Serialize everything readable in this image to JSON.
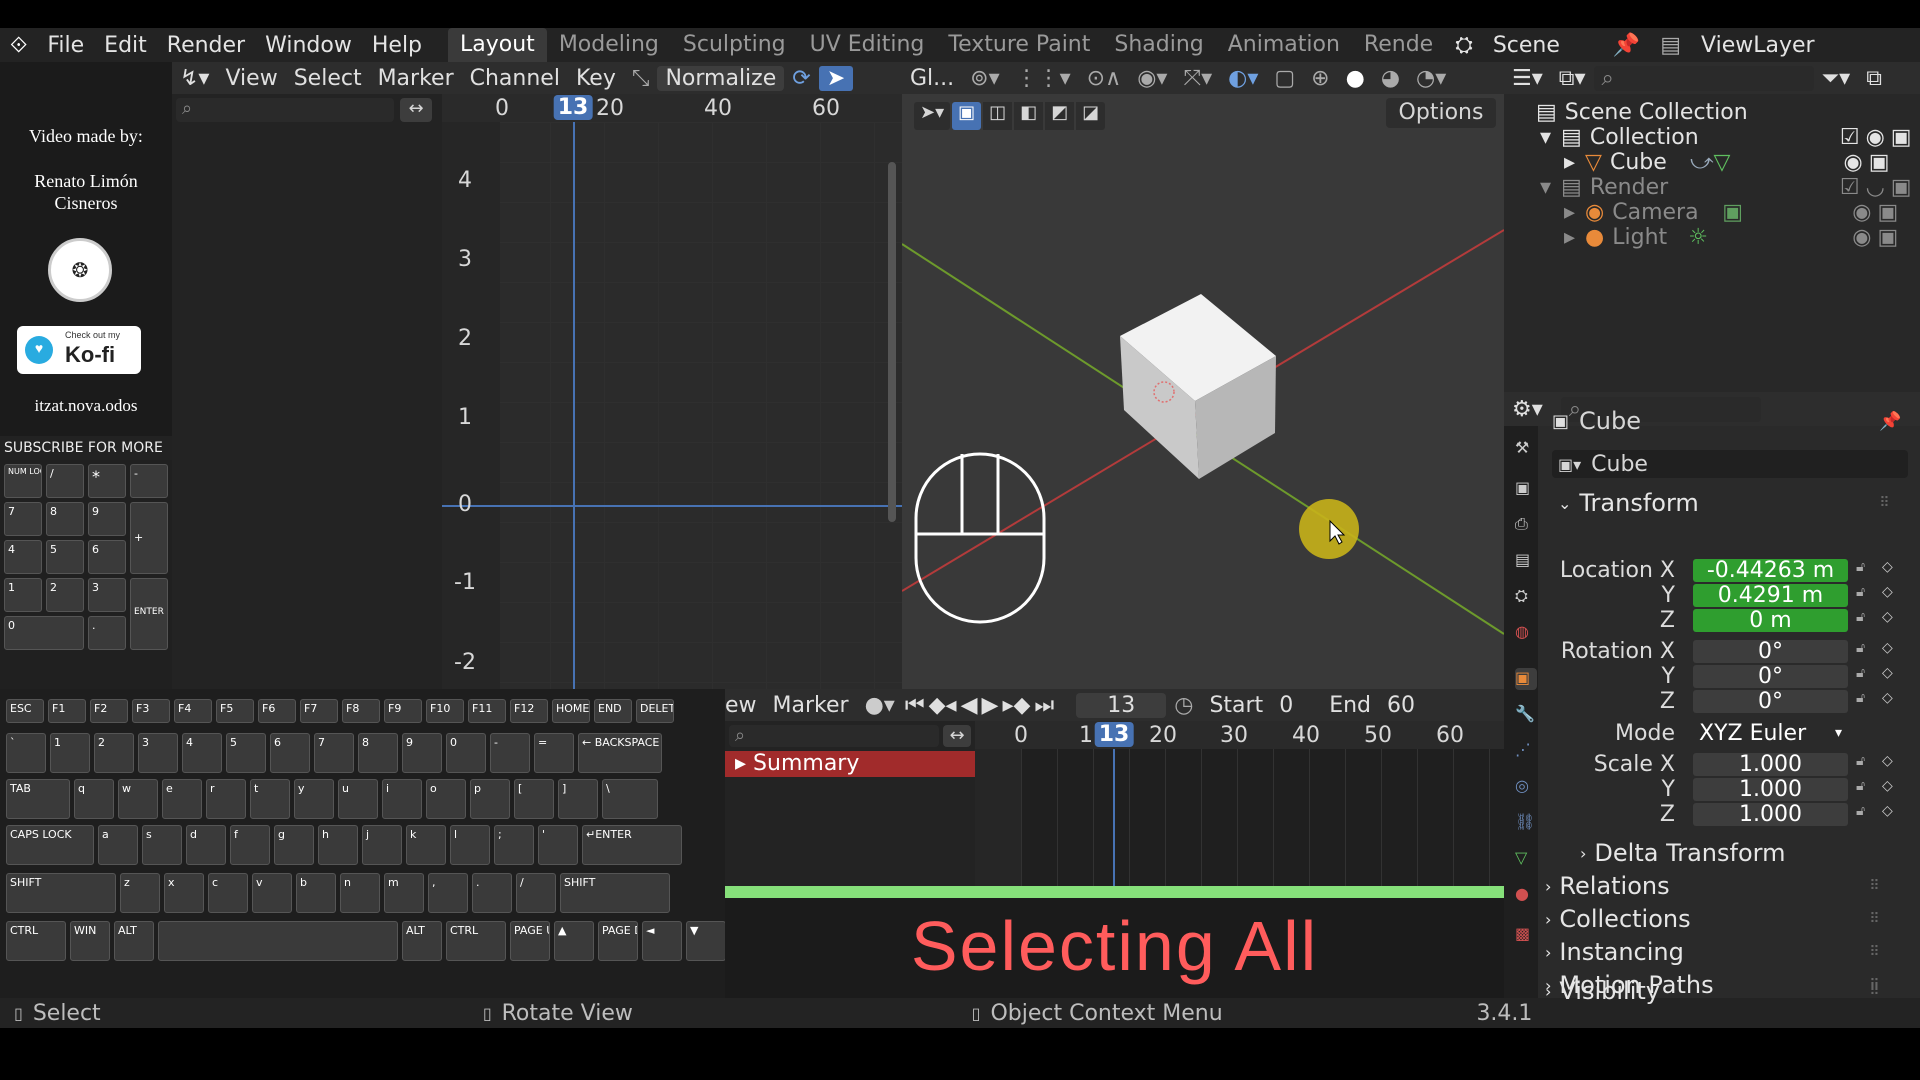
{
  "topbar": {
    "menus": [
      "File",
      "Edit",
      "Render",
      "Window",
      "Help"
    ],
    "workspaces": [
      "Layout",
      "Modeling",
      "Sculpting",
      "UV Editing",
      "Texture Paint",
      "Shading",
      "Animation",
      "Rende"
    ],
    "scene": "Scene",
    "view_layer": "ViewLayer"
  },
  "credits": {
    "made_by": "Video made by:",
    "author": "Renato Limón Cisneros",
    "kofi_small": "Check out my",
    "kofi_big": "Ko-fi",
    "handle": "itzat.nova.odos",
    "subscribe": "SUBSCRIBE FOR MORE"
  },
  "graph": {
    "menus": [
      "View",
      "Select",
      "Marker",
      "Channel",
      "Key"
    ],
    "normalize": "Normalize",
    "frame_ticks": [
      "0",
      "20",
      "40",
      "60"
    ],
    "current_frame": "13",
    "y_labels": [
      "4",
      "3",
      "2",
      "1",
      "0",
      "-1",
      "-2"
    ]
  },
  "viewport": {
    "shading_label": "Gl...",
    "options": "Options"
  },
  "timeline": {
    "view_partial": "ew",
    "marker": "Marker",
    "current_frame": "13",
    "start_label": "Start",
    "start_value": "0",
    "end_label": "End",
    "end_value": "60",
    "ticks": [
      "0",
      "1",
      "20",
      "30",
      "40",
      "50",
      "60"
    ],
    "summary": "Summary"
  },
  "caption": "Selecting All",
  "outliner": {
    "scene_collection": "Scene Collection",
    "rows": [
      "Collection",
      "Cube",
      "Render",
      "Camera",
      "Light"
    ]
  },
  "properties": {
    "object_name": "Cube",
    "data_name": "Cube",
    "transform": "Transform",
    "location_label": "Location X",
    "loc": [
      "-0.44263 m",
      "0.4291 m",
      "0 m"
    ],
    "rotation_label": "Rotation X",
    "rot": [
      "0°",
      "0°",
      "0°"
    ],
    "mode_label": "Mode",
    "mode_value": "XYZ Euler",
    "scale_label": "Scale X",
    "scale": [
      "1.000",
      "1.000",
      "1.000"
    ],
    "y": "Y",
    "z": "Z",
    "sections": [
      "Delta Transform",
      "Relations",
      "Collections",
      "Instancing",
      "Motion Paths",
      "Visibility"
    ]
  },
  "keyboard": {
    "fkeys": [
      "ESC",
      "F1",
      "F2",
      "F3",
      "F4",
      "F5",
      "F6",
      "F7",
      "F8",
      "F9",
      "F10",
      "F11",
      "F12",
      "HOME",
      "END",
      "DELETE"
    ],
    "numrow": [
      "`",
      "1",
      "2",
      "3",
      "4",
      "5",
      "6",
      "7",
      "8",
      "9",
      "0",
      "-",
      "=",
      "← BACKSPACE"
    ],
    "qrow": [
      "TAB",
      "q",
      "w",
      "e",
      "r",
      "t",
      "y",
      "u",
      "i",
      "o",
      "p",
      "[",
      "]",
      "\\"
    ],
    "arow": [
      "CAPS LOCK",
      "a",
      "s",
      "d",
      "f",
      "g",
      "h",
      "j",
      "k",
      "l",
      ";",
      "'",
      "↵ENTER"
    ],
    "zrow": [
      "SHIFT",
      "z",
      "x",
      "c",
      "v",
      "b",
      "n",
      "m",
      ",",
      ".",
      "/",
      "SHIFT"
    ],
    "bottom": [
      "CTRL",
      "WIN",
      "ALT",
      "ALT",
      "CTRL",
      "PAGE UP",
      "▲",
      "PAGE DN",
      "◄",
      "▼",
      "►"
    ],
    "numpad": [
      "NUM LOCK",
      "/",
      "*",
      "-",
      "7",
      "8",
      "9",
      "+",
      "4",
      "5",
      "6",
      "1",
      "2",
      "3",
      "ENTER",
      "0",
      "."
    ]
  },
  "status": {
    "select": "Select",
    "rotate": "Rotate View",
    "context": "Object Context Menu",
    "version": "3.4.1"
  }
}
